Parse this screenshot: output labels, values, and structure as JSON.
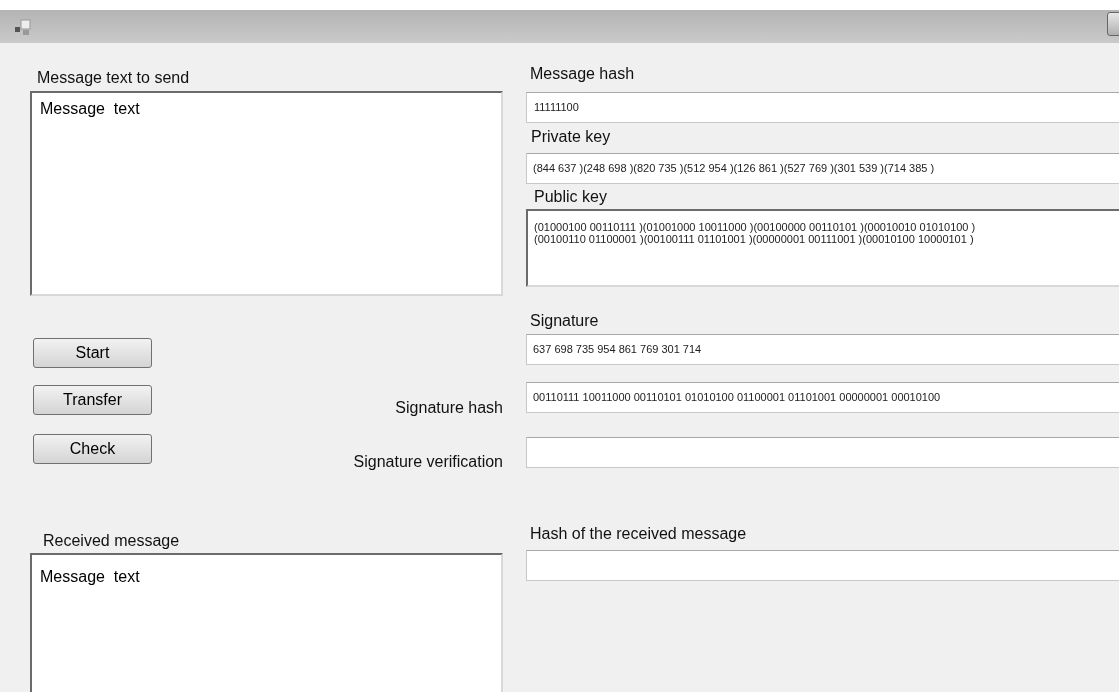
{
  "sender": {
    "label": "Message text to send",
    "text": "Message  text"
  },
  "buttons": [
    {
      "label": "Start"
    },
    {
      "label": "Transfer"
    },
    {
      "label": "Check"
    }
  ],
  "side_labels": {
    "signature_hash": "Signature hash",
    "signature_verification": "Signature verification"
  },
  "receiver": {
    "label": "Received message",
    "text": "Message  text"
  },
  "message_hash": {
    "label": "Message hash",
    "value": "11111100"
  },
  "private_key": {
    "label": "Private key",
    "value": "(844 637 )(248 698 )(820 735 )(512 954 )(126 861 )(527 769 )(301 539 )(714 385 )"
  },
  "public_key": {
    "label": "Public key",
    "lines": [
      "(01000100 00110111 )(01001000 10011000 )(00100000 00110101 )(00010010 01010100 )",
      "(00100110 01100001 )(00100111 01101001 )(00000001 00111001 )(00010100 10000101 )"
    ]
  },
  "signature": {
    "label": "Signature",
    "value": "637 698 735 954 861 769 301 714"
  },
  "signature_hash": {
    "value": "00110111 10011000 00110101 01010100 01100001 01101001 00000001 00010100"
  },
  "received_hash": {
    "label": "Hash of the received message"
  }
}
